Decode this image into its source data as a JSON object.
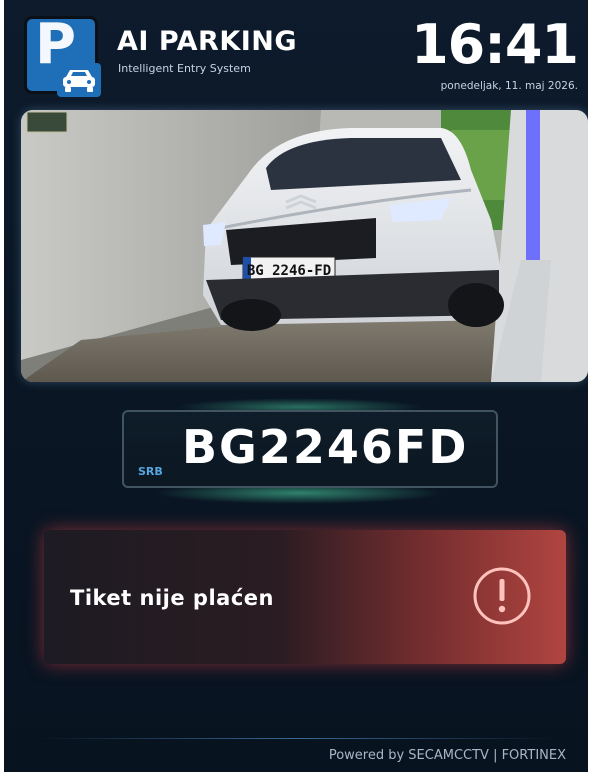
{
  "header": {
    "logo_letter": "P",
    "logo_icon": "car-icon",
    "title": "AI PARKING",
    "subtitle": "Intelligent Entry System",
    "time": "16:41",
    "date": "ponedeljak, 11. maj 2026."
  },
  "camera": {
    "feed_icon": "camera-feed",
    "vehicle_plate_text": "BG 2246-FD"
  },
  "plate": {
    "country": "SRB",
    "number": "BG2246FD"
  },
  "status": {
    "message": "Tiket nije plaćen",
    "icon": "exclamation-circle-icon",
    "color": "#b04540"
  },
  "footer": {
    "text": "Powered by SECAMCCTV | FORTINEX"
  },
  "colors": {
    "background": "#0a1624",
    "brand_blue": "#1f6fb8",
    "plate_glow": "#50dcaa",
    "alert_red": "#d84a45"
  }
}
